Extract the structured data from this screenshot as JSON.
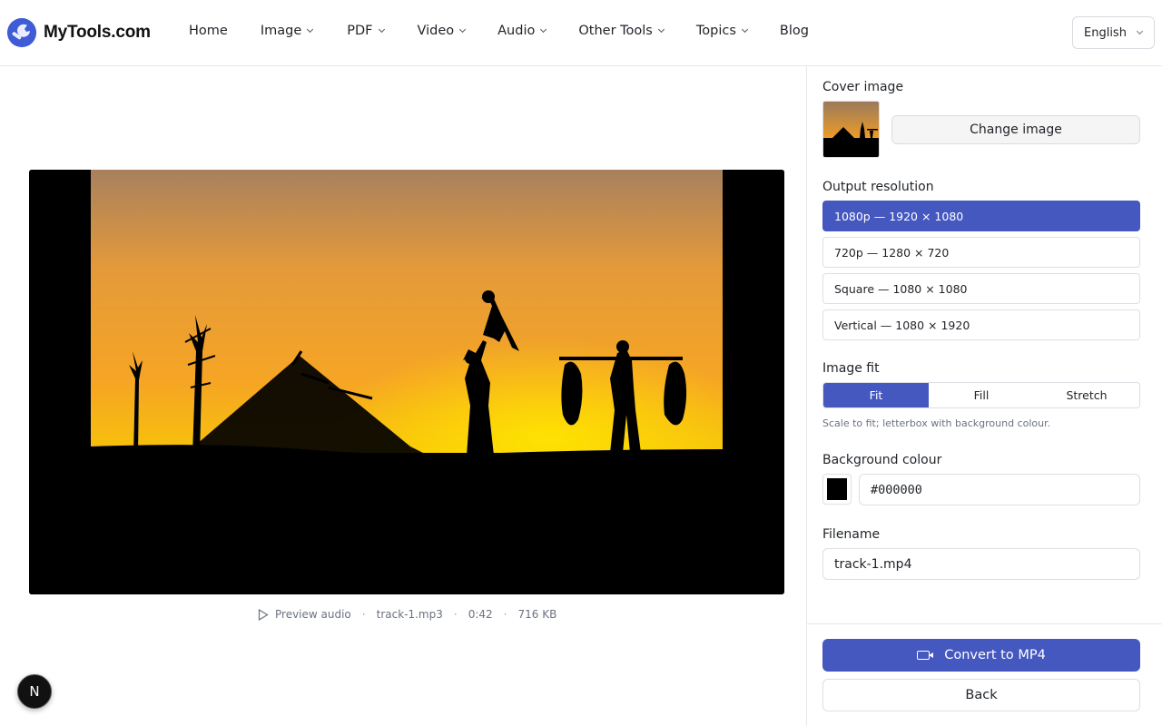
{
  "brand": {
    "name": "MyTools.com",
    "accent": "#4458c0"
  },
  "nav": [
    {
      "label": "Home",
      "dropdown": false
    },
    {
      "label": "Image",
      "dropdown": true
    },
    {
      "label": "PDF",
      "dropdown": true
    },
    {
      "label": "Video",
      "dropdown": true
    },
    {
      "label": "Audio",
      "dropdown": true
    },
    {
      "label": "Other Tools",
      "dropdown": true
    },
    {
      "label": "Topics",
      "dropdown": true
    },
    {
      "label": "Blog",
      "dropdown": false
    }
  ],
  "language": {
    "selected": "English"
  },
  "preview": {
    "audio_label": "Preview audio",
    "file_name": "track-1.mp3",
    "duration": "0:42",
    "file_size": "716 KB"
  },
  "dev_badge": "N",
  "sidebar": {
    "cover_label": "Cover image",
    "change_image_label": "Change image",
    "resolution_label": "Output resolution",
    "resolutions": [
      {
        "label": "1080p — 1920 × 1080",
        "active": true
      },
      {
        "label": "720p — 1280 × 720",
        "active": false
      },
      {
        "label": "Square — 1080 × 1080",
        "active": false
      },
      {
        "label": "Vertical — 1080 × 1920",
        "active": false
      }
    ],
    "fit_label": "Image fit",
    "fit_options": [
      {
        "label": "Fit",
        "active": true
      },
      {
        "label": "Fill",
        "active": false
      },
      {
        "label": "Stretch",
        "active": false
      }
    ],
    "fit_hint": "Scale to fit; letterbox with background colour.",
    "bg_label": "Background colour",
    "bg_value": "#000000",
    "filename_label": "Filename",
    "filename_value": "track-1.mp4",
    "convert_label": "Convert to MP4",
    "back_label": "Back"
  }
}
